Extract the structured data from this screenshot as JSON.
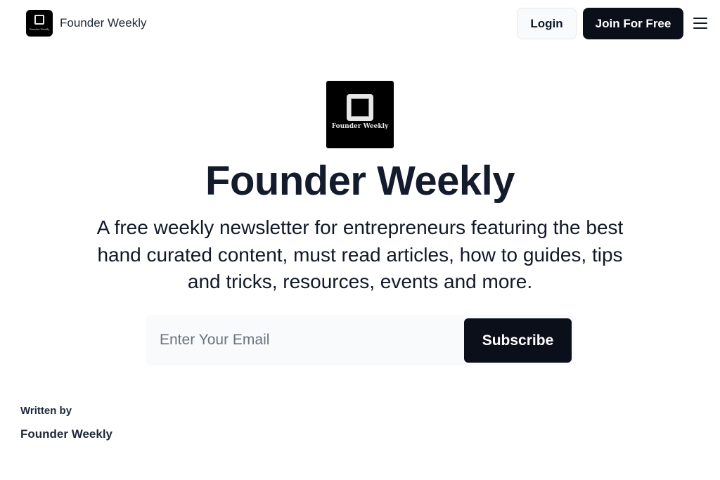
{
  "header": {
    "brand_name": "Founder Weekly",
    "logo_text": "Founder Weekly",
    "login_label": "Login",
    "join_label": "Join For Free",
    "menu_icon": "hamburger-menu-icon"
  },
  "hero": {
    "logo_caption": "Founder Weekly",
    "title": "Founder Weekly",
    "description": "A free weekly newsletter for entrepreneurs featuring the best hand curated content, must read articles, how to guides, tips and tricks, resources, events and more."
  },
  "subscribe": {
    "email_placeholder": "Enter Your Email",
    "email_value": "",
    "button_label": "Subscribe"
  },
  "author": {
    "label": "Written by",
    "name": "Founder Weekly"
  },
  "colors": {
    "primary_dark": "#0b0f19",
    "text": "#141b2d",
    "input_bg": "#f8fafc"
  }
}
